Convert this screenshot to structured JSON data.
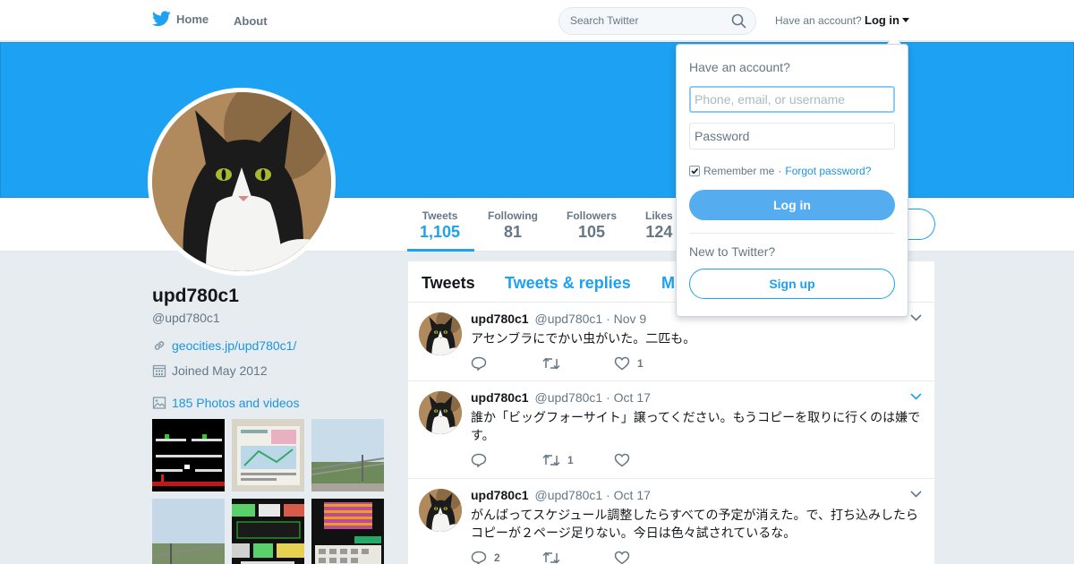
{
  "nav": {
    "home_label": "Home",
    "about_label": "About",
    "search_placeholder": "Search Twitter",
    "have_account": "Have an account?",
    "login_label": "Log in"
  },
  "profile": {
    "display_name": "upd780c1",
    "handle": "@upd780c1",
    "website": "geocities.jp/upd780c1/",
    "joined": "Joined May 2012",
    "photos_link": "185 Photos and videos"
  },
  "stats": [
    {
      "label": "Tweets",
      "value": "1,105",
      "active": true
    },
    {
      "label": "Following",
      "value": "81"
    },
    {
      "label": "Followers",
      "value": "105"
    },
    {
      "label": "Likes",
      "value": "124"
    }
  ],
  "timeline_tabs": [
    {
      "label": "Tweets",
      "active": true
    },
    {
      "label": "Tweets & replies"
    },
    {
      "label": "M"
    }
  ],
  "tweets": [
    {
      "name": "upd780c1",
      "handle": "@upd780c1",
      "time": "· Nov 9",
      "text": "アセンブラにでかい虫がいた。二匹も。",
      "reply_count": "",
      "retweet_count": "",
      "like_count": "1"
    },
    {
      "name": "upd780c1",
      "handle": "@upd780c1",
      "time": "· Oct 17",
      "text": "誰か「ビッグフォーサイト」譲ってください。もうコピーを取りに行くのは嫌です。",
      "reply_count": "",
      "retweet_count": "1",
      "like_count": ""
    },
    {
      "name": "upd780c1",
      "handle": "@upd780c1",
      "time": "· Oct 17",
      "text": "がんばってスケジュール調整したらすべての予定が消えた。で、打ち込みしたらコピーが２ページ足りない。今日は色々試されているな。",
      "reply_count": "2",
      "retweet_count": "",
      "like_count": ""
    }
  ],
  "login_dropdown": {
    "title": "Have an account?",
    "username_placeholder": "Phone, email, or username",
    "password_placeholder": "Password",
    "remember_me": "Remember me",
    "separator": " · ",
    "forgot_password": "Forgot password?",
    "login_button": "Log in",
    "new_to_twitter": "New to Twitter?",
    "signup_button": "Sign up"
  },
  "colors": {
    "brand_blue": "#1da1f2",
    "login_button": "#55acee",
    "link": "#1b95e0"
  }
}
